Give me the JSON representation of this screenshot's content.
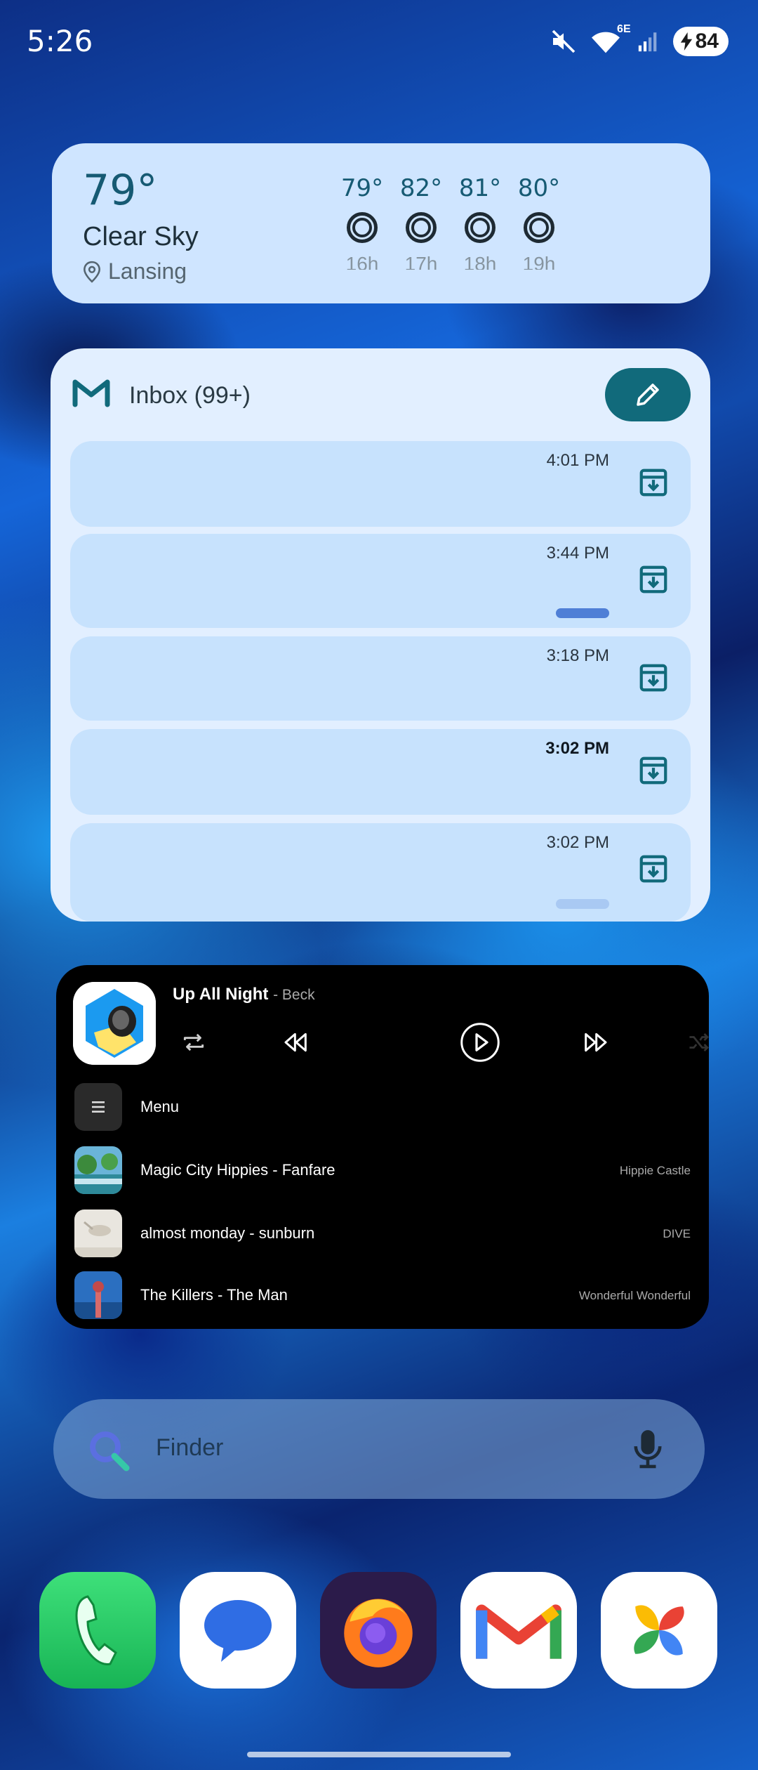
{
  "status_bar": {
    "time": "5:26",
    "network": "6E",
    "battery": "84"
  },
  "weather": {
    "temperature": "79°",
    "condition": "Clear Sky",
    "location": "Lansing",
    "forecast": [
      {
        "temp": "79°",
        "hour": "16h"
      },
      {
        "temp": "82°",
        "hour": "17h"
      },
      {
        "temp": "81°",
        "hour": "18h"
      },
      {
        "temp": "80°",
        "hour": "19h"
      }
    ]
  },
  "gmail": {
    "title": "Inbox (99+)",
    "emails": [
      {
        "time": "4:01 PM",
        "unread": false
      },
      {
        "time": "3:44 PM",
        "unread": false
      },
      {
        "time": "3:18 PM",
        "unread": false
      },
      {
        "time": "3:02 PM",
        "unread": true
      },
      {
        "time": "3:02 PM",
        "unread": false
      }
    ]
  },
  "music": {
    "song": "Up All Night",
    "artist": "- Beck",
    "menu_label": "Menu",
    "queue": [
      {
        "name": "Magic City Hippies - Fanfare",
        "album": "Hippie Castle"
      },
      {
        "name": "almost monday - sunburn",
        "album": "DIVE"
      },
      {
        "name": "The Killers - The Man",
        "album": "Wonderful Wonderful"
      }
    ]
  },
  "search": {
    "placeholder": "Finder"
  },
  "dock": {
    "apps": [
      "phone",
      "messages",
      "firefox",
      "gmail",
      "photos"
    ]
  },
  "colors": {
    "weather_bg": "#cfe5ff",
    "gmail_bg": "#e2efff",
    "gmail_row": "#c7e2fd",
    "compose_bg": "#116a7b",
    "music_bg": "#000000"
  }
}
